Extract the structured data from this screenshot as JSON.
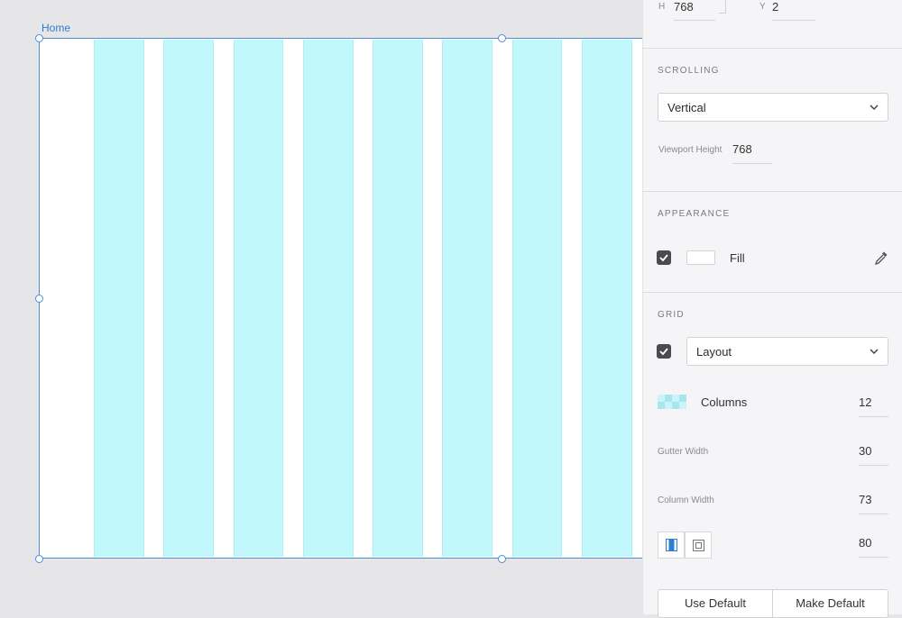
{
  "artboard": {
    "label": "Home"
  },
  "transform": {
    "h_label": "H",
    "h_value": "768",
    "y_label": "Y",
    "y_value": "2"
  },
  "scrolling": {
    "title": "SCROLLING",
    "mode": "Vertical",
    "viewport_label": "Viewport Height",
    "viewport_value": "768"
  },
  "appearance": {
    "title": "APPEARANCE",
    "fill_label": "Fill",
    "fill_checked": true,
    "fill_color": "#ffffff"
  },
  "grid": {
    "title": "GRID",
    "type": "Layout",
    "enabled": true,
    "columns_label": "Columns",
    "columns_value": "12",
    "gutter_label": "Gutter Width",
    "gutter_value": "30",
    "colwidth_label": "Column Width",
    "colwidth_value": "73",
    "margin_value": "80",
    "use_default": "Use Default",
    "make_default": "Make Default"
  },
  "colors": {
    "grid_column": "#c2f7fb",
    "selection": "#4a90d9"
  },
  "icons": [
    "eyedropper-icon",
    "chevron-down-icon",
    "checkmark-icon",
    "columns-swatch-icon",
    "linked-margins-icon",
    "individual-margins-icon"
  ]
}
